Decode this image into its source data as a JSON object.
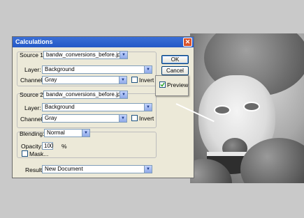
{
  "dialog": {
    "title": "Calculations",
    "source1": {
      "label": "Source 1:",
      "file": "bandw_conversions_before.jpg",
      "layer_label": "Layer:",
      "layer_value": "Background",
      "channel_label": "Channel:",
      "channel_value": "Gray",
      "invert_label": "Invert"
    },
    "source2": {
      "label": "Source 2:",
      "file": "bandw_conversions_before.jpg",
      "layer_label": "Layer:",
      "layer_value": "Background",
      "channel_label": "Channel:",
      "channel_value": "Gray",
      "invert_label": "Invert"
    },
    "blending": {
      "label": "Blending:",
      "value": "Normal",
      "opacity_label": "Opacity:",
      "opacity_value": "100",
      "opacity_unit": "%",
      "mask_label": "Mask..."
    },
    "result": {
      "label": "Result:",
      "value": "New Document"
    },
    "buttons": {
      "ok": "OK",
      "cancel": "Cancel"
    },
    "preview_label": "Preview",
    "close_glyph": "✕"
  }
}
